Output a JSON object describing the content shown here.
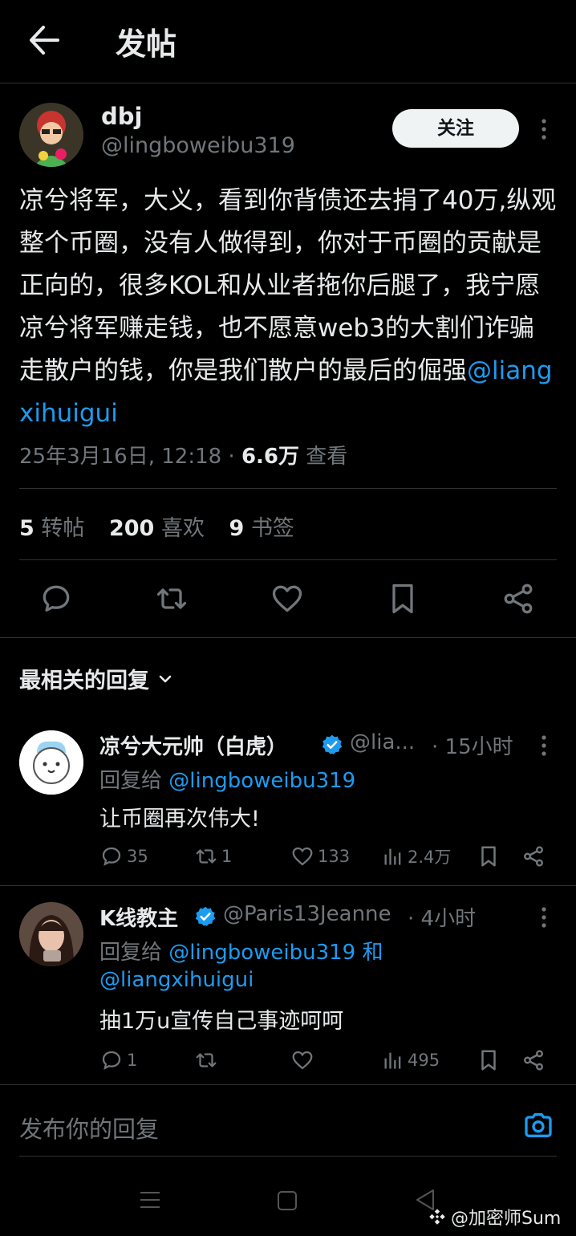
{
  "header": {
    "title": "发帖"
  },
  "post": {
    "author_name": "dbj",
    "author_handle": "@lingboweibu319",
    "follow_label": "关注",
    "text": "凉兮将军，大义，看到你背债还去捐了40万,纵观整个币圈，没有人做得到，你对于币圈的贡献是正向的，很多KOL和从业者拖你后腿了，我宁愿凉兮将军赚走钱，也不愿意web3的大割们诈骗走散户的钱，你是我们散户的最后的倔强",
    "mention": "@liangxihuigui",
    "timestamp": "25年3月16日, 12:18 · ",
    "views": "6.6万",
    "views_label": " 查看",
    "stats": [
      {
        "num": "5",
        "label": "转帖"
      },
      {
        "num": "200",
        "label": "喜欢"
      },
      {
        "num": "9",
        "label": "书签"
      }
    ]
  },
  "replies_sort_label": "最相关的回复",
  "replies": [
    {
      "name": "凉兮大元帅（白虎）",
      "handle": "@lia...",
      "time": "· 15小时",
      "reply_to_prefix": "回复给",
      "reply_to": "@lingboweibu319",
      "text": "让币圈再次伟大!",
      "replies": "35",
      "retweets": "1",
      "likes": "133",
      "views": "2.4万"
    },
    {
      "name": "K线教主",
      "handle": "@Paris13Jeanne",
      "time": "· 4小时",
      "reply_to_prefix": "回复给",
      "reply_to": "@lingboweibu319 和",
      "reply_to_2": "@liangxihuigui",
      "text": "抽1万u宣传自己事迹呵呵",
      "replies": "1",
      "retweets": "",
      "likes": "",
      "views": "495"
    }
  ],
  "compose": {
    "placeholder": "发布你的回复"
  },
  "watermark": "@加密师Sum",
  "colors": {
    "accent": "#1d9bf0",
    "muted": "#71767b",
    "text": "#e7e9ea",
    "background": "#000000"
  }
}
